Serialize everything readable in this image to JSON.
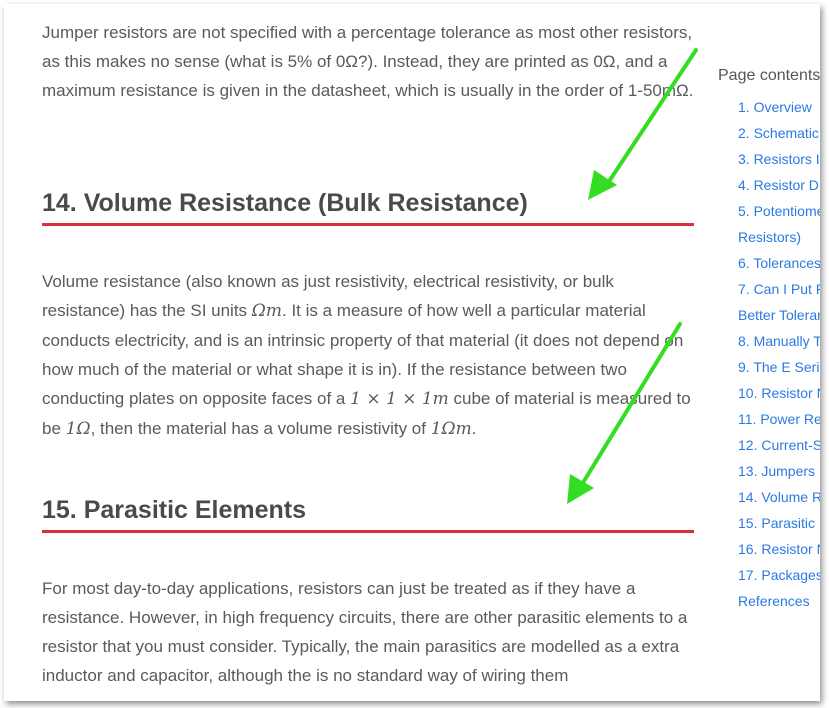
{
  "article": {
    "para1": "Jumper resistors are not specified with a percentage tolerance as most other resistors, as this makes no sense (what is 5% of 0Ω?). Instead, they are printed as 0Ω, and a maximum resistance is given in the datasheet, which is usually in the order of 1-50mΩ.",
    "heading14": "14. Volume Resistance (Bulk Resistance)",
    "para2": {
      "t1": "Volume resistance (also known as just resistivity, electrical resistivity, or bulk resistance) has the SI units ",
      "m1": "Ωm",
      "t2": ". It is a measure of how well a particular material conducts electricity, and is an intrinsic property of that material (it does not depend on how much of the material or what shape it is in). If the resistance between two conducting plates on opposite faces of a ",
      "m2": "1 × 1 × 1m",
      "t3": " cube of material is measured to be ",
      "m3": "1Ω",
      "t4": ", then the material has a volume resistivity of ",
      "m4": "1Ωm",
      "t5": "."
    },
    "heading15": "15. Parasitic Elements",
    "para3": "For most day-to-day applications, resistors can just be treated as if they have a resistance. However, in high frequency circuits, there are other parasitic elements to a resistor that you must consider. Typically, the main parasitics are modelled as a extra inductor and capacitor, although the is no standard way of wiring them"
  },
  "toc": {
    "title": "Page contents",
    "items": [
      "1. Overview",
      "2. Schematic",
      "3. Resistors I",
      "4. Resistor D",
      "5. Potentiome",
      "Resistors)",
      "6. Tolerances",
      "7. Can I Put R",
      "Better Toleran",
      "8. Manually T",
      "9. The E Seri",
      "10. Resistor N",
      "11. Power Re",
      "12. Current-S",
      "13. Jumpers",
      "14. Volume R",
      "15. Parasitic",
      "16. Resistor N",
      "17. Packages",
      "References"
    ]
  },
  "colors": {
    "heading_underline": "#d6303f",
    "link": "#2a7ae2",
    "annotation_arrow": "#33dd22"
  }
}
